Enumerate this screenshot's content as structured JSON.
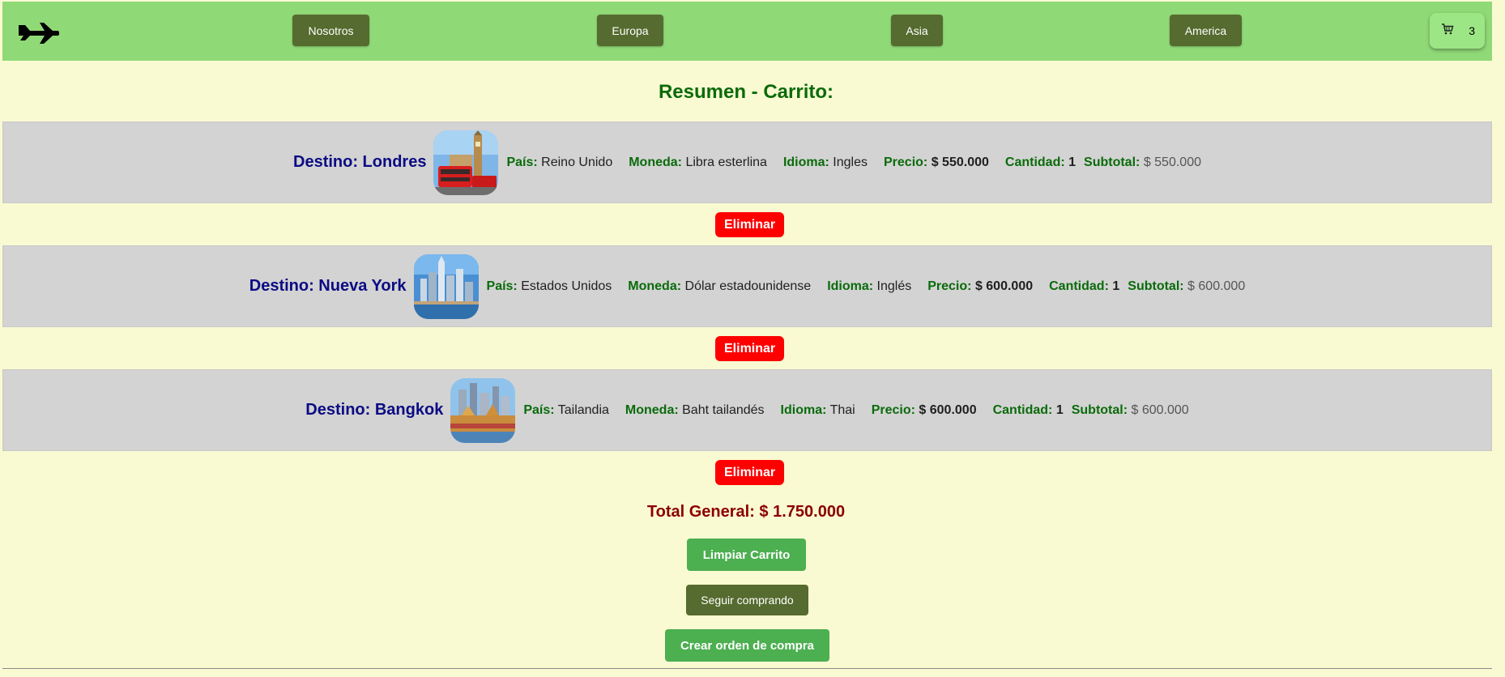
{
  "nav": {
    "links": [
      {
        "label": "Nosotros"
      },
      {
        "label": "Europa"
      },
      {
        "label": "Asia"
      },
      {
        "label": "America"
      }
    ],
    "cart_count": "3"
  },
  "page_title": "Resumen - Carrito:",
  "labels": {
    "pais": "País:",
    "moneda": "Moneda:",
    "idioma": "Idioma:",
    "precio": "Precio:",
    "cantidad": "Cantidad:",
    "subtotal": "Subtotal:"
  },
  "items": [
    {
      "destino": "Destino: Londres",
      "pais": "Reino Unido",
      "moneda": "Libra esterlina",
      "idioma": "Ingles",
      "precio": "$ 550.000",
      "cantidad": "1",
      "subtotal": "$ 550.000",
      "delete_label": "Eliminar"
    },
    {
      "destino": "Destino: Nueva York",
      "pais": "Estados Unidos",
      "moneda": "Dólar estadounidense",
      "idioma": "Inglés",
      "precio": "$ 600.000",
      "cantidad": "1",
      "subtotal": "$ 600.000",
      "delete_label": "Eliminar"
    },
    {
      "destino": "Destino: Bangkok",
      "pais": "Tailandia",
      "moneda": "Baht tailandés",
      "idioma": "Thai",
      "precio": "$ 600.000",
      "cantidad": "1",
      "subtotal": "$ 600.000",
      "delete_label": "Eliminar"
    }
  ],
  "total_general": "Total General: $ 1.750.000",
  "actions": {
    "clear_cart": "Limpiar Carrito",
    "continue_shopping": "Seguir comprando",
    "create_order": "Crear orden de compra"
  },
  "icons": {
    "logo": "airplane-icon",
    "cart": "cart-icon"
  },
  "colors": {
    "navbar": "#90d977",
    "page_bg": "#fafad2",
    "nav_button": "#556b2f",
    "delete_button": "#ff0000",
    "primary_button": "#4caf50",
    "title": "#0a6b0a",
    "destination": "#0b0b84",
    "total": "#8b0000"
  }
}
